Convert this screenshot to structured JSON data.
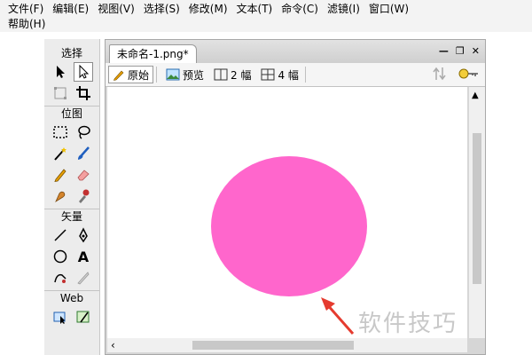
{
  "menu": {
    "row1": [
      "文件(F)",
      "编辑(E)",
      "视图(V)",
      "选择(S)",
      "修改(M)",
      "文本(T)",
      "命令(C)",
      "滤镜(I)",
      "窗口(W)"
    ],
    "row2": [
      "帮助(H)"
    ]
  },
  "tools": {
    "sections": [
      "选择",
      "位图",
      "矢量",
      "Web"
    ],
    "select_icons": [
      "pointer-tool-icon",
      "subselection-tool-icon",
      "scale-tool-icon",
      "crop-tool-icon"
    ],
    "bitmap_icons": [
      "marquee-tool-icon",
      "lasso-tool-icon",
      "magic-wand-icon",
      "brush-tool-icon",
      "pencil-tool-icon",
      "eraser-tool-icon",
      "blur-tool-icon",
      "rubber-stamp-icon"
    ],
    "vector_icons": [
      "line-tool-icon",
      "pen-tool-icon",
      "ellipse-tool-icon",
      "text-tool-icon",
      "freeform-tool-icon",
      "knife-tool-icon"
    ],
    "web_icons": [
      "hotspot-tool-icon",
      "slice-tool-icon"
    ],
    "text_tool_glyph": "A"
  },
  "document": {
    "tab_title": "未命名-1.png*",
    "view_buttons": {
      "original": "原始",
      "preview": "预览",
      "two_up": "2 幅",
      "four_up": "4 幅"
    }
  },
  "canvas": {
    "shape_color": "#ff66cc"
  },
  "annotation": {
    "watermark": "软件技巧",
    "arrow_color": "#e53b2f"
  }
}
